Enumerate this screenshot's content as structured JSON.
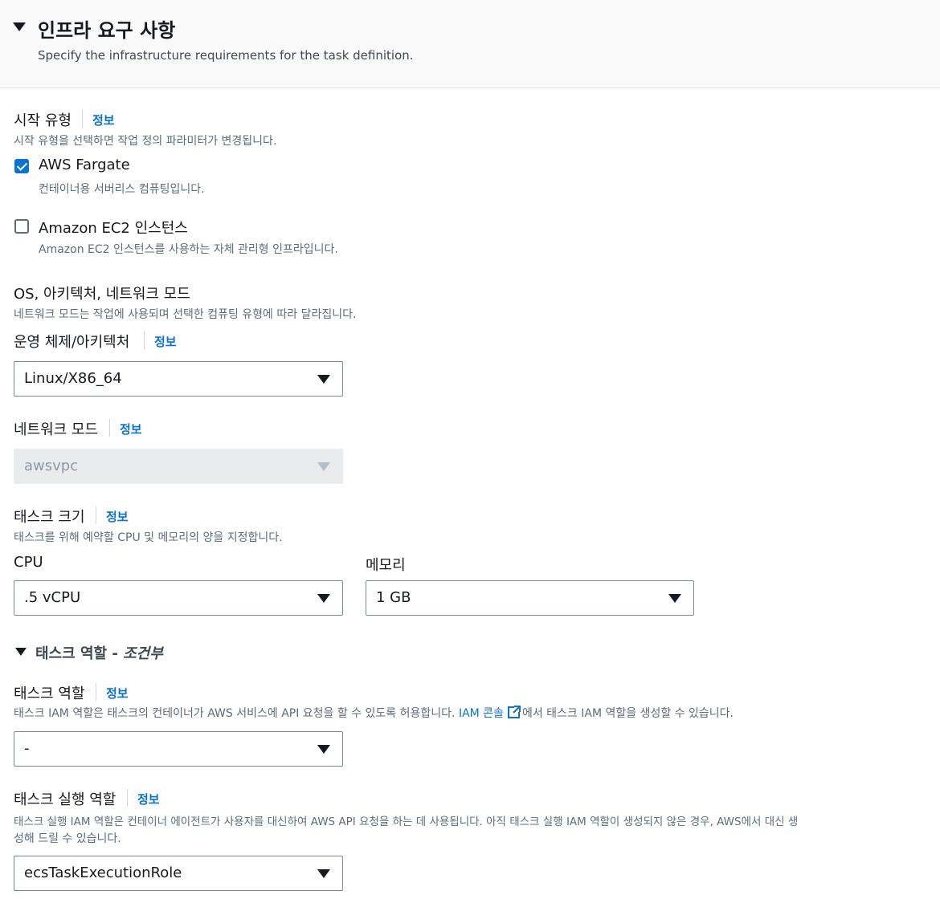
{
  "section": {
    "title": "인프라 요구 사항",
    "description": "Specify the infrastructure requirements for the task definition."
  },
  "info_label": "정보",
  "launch_type": {
    "label": "시작 유형",
    "hint": "시작 유형을 선택하면 작업 정의 파라미터가 변경됩니다.",
    "options": [
      {
        "label": "AWS Fargate",
        "description": "컨테이너용 서버리스 컴퓨팅입니다.",
        "checked": true
      },
      {
        "label": "Amazon EC2 인스턴스",
        "description": "Amazon EC2 인스턴스를 사용하는 자체 관리형 인프라입니다.",
        "checked": false
      }
    ]
  },
  "os_network": {
    "label": "OS, 아키텍처, 네트워크 모드",
    "hint": "네트워크 모드는 작업에 사용되며 선택한 컴퓨팅 유형에 따라 달라집니다."
  },
  "os_arch": {
    "label": "운영 체제/아키텍처",
    "value": "Linux/X86_64"
  },
  "network_mode": {
    "label": "네트워크 모드",
    "value": "awsvpc",
    "disabled": true
  },
  "task_size": {
    "label": "태스크 크기",
    "hint": "태스크를 위해 예약할 CPU 및 메모리의 양을 지정합니다.",
    "cpu_label": "CPU",
    "cpu_value": ".5 vCPU",
    "memory_label": "메모리",
    "memory_value": "1 GB"
  },
  "task_role_section": {
    "title": "태스크 역할 - ",
    "title_suffix": "조건부"
  },
  "task_role": {
    "label": "태스크 역할",
    "hint_before": "태스크 IAM 역할은 태스크의 컨테이너가 AWS 서비스에 API 요청을 할 수 있도록 허용합니다. ",
    "hint_link": "IAM 콘솔",
    "hint_after": "에서 태스크 IAM 역할을 생성할 수 있습니다.",
    "value": "-"
  },
  "execution_role": {
    "label": "태스크 실행 역할",
    "hint_line1": "태스크 실행 IAM 역할은 컨테이너 에이전트가 사용자를 대신하여 AWS API 요청을 하는 데 사용됩니다. 아직 태스크 실행 IAM 역할이 생성되지 않은 경우, AWS에서 대신 생",
    "hint_line2": "성해 드릴 수 있습니다.",
    "value": "ecsTaskExecutionRole"
  },
  "colors": {
    "accent": "#0972d3",
    "text": "#16191f",
    "muted": "#5f6b7a",
    "header_bg": "#fafafa",
    "disabled_bg": "#e9ebed"
  }
}
